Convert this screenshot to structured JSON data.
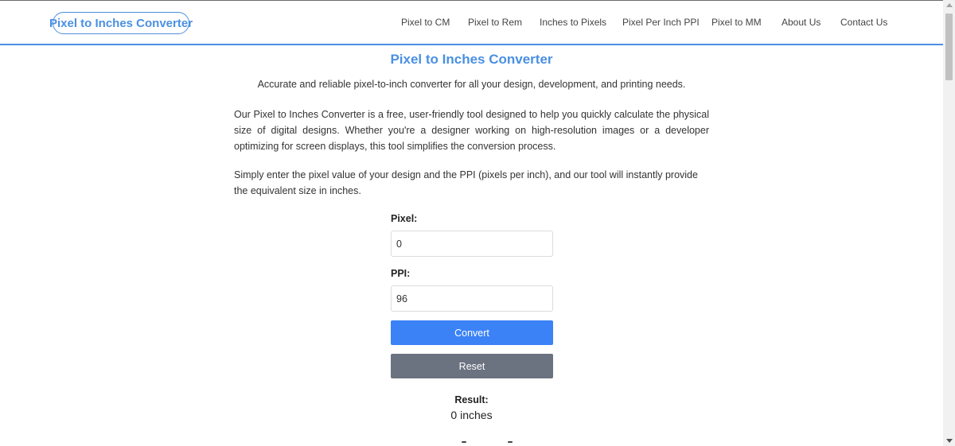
{
  "header": {
    "logo": "Pixel to Inches Converter",
    "nav": [
      "Pixel to CM",
      "Pixel to Rem",
      "Inches to Pixels",
      "Pixel Per Inch PPI",
      "Pixel to MM",
      "About Us",
      "Contact Us"
    ]
  },
  "main": {
    "title": "Pixel to Inches Converter",
    "subtitle": "Accurate and reliable pixel-to-inch converter for all your design, development, and printing needs.",
    "paragraph1": "Our Pixel to Inches Converter is a free, user-friendly tool designed to help you quickly calculate the physical size of digital designs. Whether you're a designer working on high-resolution images or a developer optimizing for screen displays, this tool simplifies the conversion process.",
    "paragraph2": "Simply enter the pixel value of your design and the PPI (pixels per inch), and our tool will instantly provide the equivalent size in inches."
  },
  "form": {
    "pixel_label": "Pixel:",
    "pixel_value": "0",
    "ppi_label": "PPI:",
    "ppi_value": "96",
    "convert_label": "Convert",
    "reset_label": "Reset"
  },
  "result": {
    "label": "Result:",
    "value": "0 inches"
  },
  "colors": {
    "accent": "#4a90e2",
    "convert_button": "#3b82f6",
    "reset_button": "#6b7280"
  }
}
